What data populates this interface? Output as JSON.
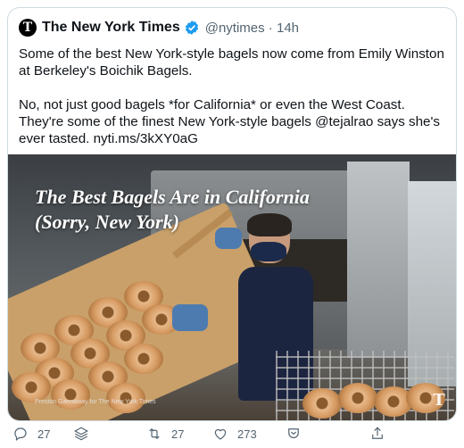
{
  "tweet": {
    "author_name": "The New York Times",
    "logo_letter": "T",
    "handle_time": "@nytimes · 14h",
    "text_paragraphs": [
      "Some of the best New York-style bagels now come from Emily Winston at Berkeley's Boichik Bagels.",
      "No, not just good bagels *for California* or even the West Coast. They're some of the finest New York-style bagels @tejalrao says she's ever tasted. nyti.ms/3kXY0aG"
    ]
  },
  "media": {
    "headline_line1": "The Best Bagels Are in California",
    "headline_line2": "(Sorry, New York)",
    "credit": "Preston Gannaway for The New York Times",
    "watermark": "T"
  },
  "actions": {
    "reply_count": "27",
    "retweet_count": "27",
    "like_count": "273"
  },
  "colors": {
    "verified": "#1d9bf0",
    "muted": "#536471",
    "border": "#cfd9de"
  }
}
